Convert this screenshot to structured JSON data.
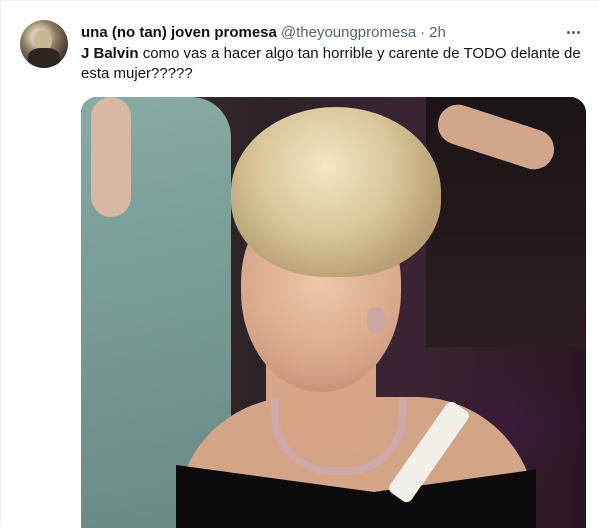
{
  "tweet": {
    "author_name": "una (no tan) joven promesa",
    "handle": "@theyoungpromesa",
    "separator": "·",
    "time": "2h",
    "text_bold": "J Balvin",
    "text_rest": " como vas a hacer algo tan horrible y carente de TODO delante de esta mujer?????"
  },
  "icons": {
    "more": "more-dots-icon",
    "avatar": "profile-avatar"
  },
  "colors": {
    "primary_text": "#0f1419",
    "secondary_text": "#536471",
    "divider": "#eff3f4"
  }
}
